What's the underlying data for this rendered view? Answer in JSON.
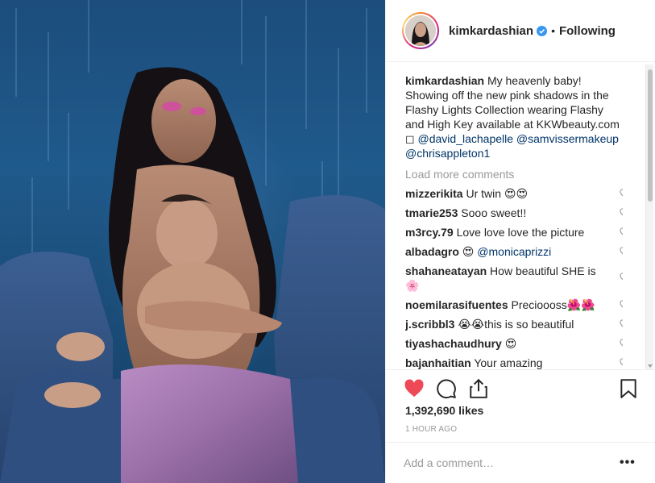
{
  "post": {
    "photo_alt_subject": "woman-holding-baby-photo"
  },
  "header": {
    "username": "kimkardashian",
    "dot": "•",
    "following_label": "Following",
    "verified_icon": "verified-badge-icon"
  },
  "caption": {
    "username": "kimkardashian",
    "text": " My heavenly baby! Showing off the new pink shadows in the Flashy Lights Collection wearing Flashy and High Key available at KKWbeauty.com ",
    "glyph": "◻",
    "mention_1": "@david_lachapelle",
    "mention_2": "@samvissermakeup",
    "mention_3": "@chrisappleton1"
  },
  "load_more_label": "Load more comments",
  "comments": [
    {
      "user": "mizzerikita",
      "text": " Ur twin 😍😍"
    },
    {
      "user": "tmarie253",
      "text": " Sooo sweet!!"
    },
    {
      "user": "m3rcy.79",
      "text": " Love love love the picture"
    },
    {
      "user": "albadagro",
      "text": " 😍 ",
      "mention": "@monicaprizzi"
    },
    {
      "user": "shahaneatayan",
      "text": " How beautiful SHE is 🌸"
    },
    {
      "user": "noemilarasifuentes",
      "text": " Precioooss🌺🌺"
    },
    {
      "user": "j.scribbl3",
      "text": " 😭😭this is so beautiful"
    },
    {
      "user": "tiyashachaudhury",
      "text": " 😍"
    },
    {
      "user": "bajanhaitian",
      "text": " Your amazing"
    }
  ],
  "actions": {
    "like_icon": "heart-filled-icon",
    "comment_icon": "comment-bubble-icon",
    "share_icon": "share-icon",
    "save_icon": "bookmark-icon",
    "like_color": "#ed4956"
  },
  "likes_text": "1,392,690 likes",
  "time_ago": "1 HOUR AGO",
  "add_comment": {
    "placeholder": "Add a comment…",
    "more_label": "•••"
  }
}
